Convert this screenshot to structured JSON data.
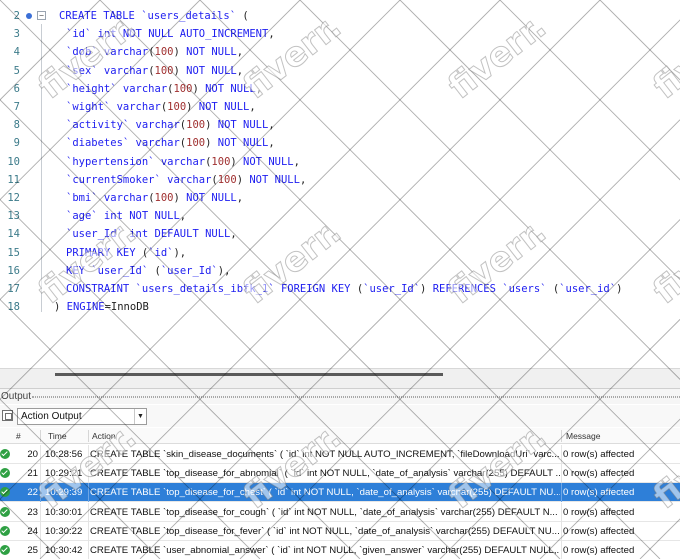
{
  "editor": {
    "lines": [
      {
        "n": "2",
        "t": [
          [
            "kw",
            "CREATE TABLE "
          ],
          [
            "id",
            "`users_details`"
          ],
          [
            "tx",
            " ("
          ]
        ]
      },
      {
        "n": "3",
        "t": [
          [
            "id",
            "`id`"
          ],
          [
            "kw",
            " int NOT NULL AUTO_INCREMENT"
          ],
          [
            "tx",
            ","
          ]
        ]
      },
      {
        "n": "4",
        "t": [
          [
            "id",
            "`dob`"
          ],
          [
            "kw",
            " varchar"
          ],
          [
            "tx",
            "("
          ],
          [
            "num",
            "100"
          ],
          [
            "tx",
            ")"
          ],
          [
            "kw",
            " NOT NULL"
          ],
          [
            "tx",
            ","
          ]
        ]
      },
      {
        "n": "5",
        "t": [
          [
            "id",
            "`sex`"
          ],
          [
            "kw",
            " varchar"
          ],
          [
            "tx",
            "("
          ],
          [
            "num",
            "100"
          ],
          [
            "tx",
            ")"
          ],
          [
            "kw",
            " NOT NULL"
          ],
          [
            "tx",
            ","
          ]
        ]
      },
      {
        "n": "6",
        "t": [
          [
            "id",
            "`height`"
          ],
          [
            "kw",
            " varchar"
          ],
          [
            "tx",
            "("
          ],
          [
            "num",
            "100"
          ],
          [
            "tx",
            ")"
          ],
          [
            "kw",
            " NOT NULL"
          ],
          [
            "tx",
            ","
          ]
        ]
      },
      {
        "n": "7",
        "t": [
          [
            "id",
            "`wight`"
          ],
          [
            "kw",
            " varchar"
          ],
          [
            "tx",
            "("
          ],
          [
            "num",
            "100"
          ],
          [
            "tx",
            ")"
          ],
          [
            "kw",
            " NOT NULL"
          ],
          [
            "tx",
            ","
          ]
        ]
      },
      {
        "n": "8",
        "t": [
          [
            "id",
            "`activity`"
          ],
          [
            "kw",
            " varchar"
          ],
          [
            "tx",
            "("
          ],
          [
            "num",
            "100"
          ],
          [
            "tx",
            ")"
          ],
          [
            "kw",
            " NOT NULL"
          ],
          [
            "tx",
            ","
          ]
        ]
      },
      {
        "n": "9",
        "t": [
          [
            "id",
            "`diabetes`"
          ],
          [
            "kw",
            " varchar"
          ],
          [
            "tx",
            "("
          ],
          [
            "num",
            "100"
          ],
          [
            "tx",
            ")"
          ],
          [
            "kw",
            " NOT NULL"
          ],
          [
            "tx",
            ","
          ]
        ]
      },
      {
        "n": "10",
        "t": [
          [
            "id",
            "`hypertension`"
          ],
          [
            "kw",
            " varchar"
          ],
          [
            "tx",
            "("
          ],
          [
            "num",
            "100"
          ],
          [
            "tx",
            ")"
          ],
          [
            "kw",
            " NOT NULL"
          ],
          [
            "tx",
            ","
          ]
        ]
      },
      {
        "n": "11",
        "t": [
          [
            "id",
            "`currentSmoker`"
          ],
          [
            "kw",
            " varchar"
          ],
          [
            "tx",
            "("
          ],
          [
            "num",
            "100"
          ],
          [
            "tx",
            ")"
          ],
          [
            "kw",
            " NOT NULL"
          ],
          [
            "tx",
            ","
          ]
        ]
      },
      {
        "n": "12",
        "t": [
          [
            "id",
            "`bmi`"
          ],
          [
            "kw",
            " varchar"
          ],
          [
            "tx",
            "("
          ],
          [
            "num",
            "100"
          ],
          [
            "tx",
            ")"
          ],
          [
            "kw",
            " NOT NULL"
          ],
          [
            "tx",
            ","
          ]
        ]
      },
      {
        "n": "13",
        "t": [
          [
            "id",
            "`age`"
          ],
          [
            "kw",
            " int NOT NULL"
          ],
          [
            "tx",
            ","
          ]
        ]
      },
      {
        "n": "14",
        "t": [
          [
            "id",
            "`user_Id`"
          ],
          [
            "kw",
            " int DEFAULT NULL"
          ],
          [
            "tx",
            ","
          ]
        ]
      },
      {
        "n": "15",
        "t": [
          [
            "kw",
            "PRIMARY KEY "
          ],
          [
            "tx",
            "("
          ],
          [
            "id",
            "`id`"
          ],
          [
            "tx",
            "),"
          ]
        ]
      },
      {
        "n": "16",
        "t": [
          [
            "kw",
            "KEY "
          ],
          [
            "id",
            "`user_Id`"
          ],
          [
            "tx",
            " ("
          ],
          [
            "id",
            "`user_Id`"
          ],
          [
            "tx",
            "),"
          ]
        ]
      },
      {
        "n": "17",
        "t": [
          [
            "kw",
            "CONSTRAINT "
          ],
          [
            "id",
            "`users_details_ibfk_1`"
          ],
          [
            "kw",
            " FOREIGN KEY "
          ],
          [
            "tx",
            "("
          ],
          [
            "id",
            "`user_Id`"
          ],
          [
            "tx",
            ") "
          ],
          [
            "kw",
            "REFERENCES "
          ],
          [
            "id",
            "`users`"
          ],
          [
            "tx",
            " ("
          ],
          [
            "id",
            "`user_id`"
          ],
          [
            "tx",
            ")"
          ]
        ]
      },
      {
        "n": "18",
        "t": [
          [
            "tx",
            ") "
          ],
          [
            "kw",
            "ENGINE"
          ],
          [
            "tx",
            "=InnoDB"
          ]
        ]
      }
    ]
  },
  "output": {
    "title": "Output",
    "dropdown_value": "Action Output",
    "columns": {
      "time": "Time",
      "action": "Action",
      "message": "Message",
      "num": "#"
    },
    "rows": [
      {
        "num": "20",
        "time": "10:28:56",
        "action": "CREATE TABLE `skin_disease_documents` (   `id` int NOT NULL AUTO_INCREMENT,   `fileDownloadUri` varc...",
        "message": "0 row(s) affected",
        "selected": false
      },
      {
        "num": "21",
        "time": "10:29:21",
        "action": "CREATE TABLE `top_disease_for_abnomial` (   `id` int NOT NULL,   `date_of_analysis` varchar(255) DEFAULT ...",
        "message": "0 row(s) affected",
        "selected": false
      },
      {
        "num": "22",
        "time": "10:29:39",
        "action": "CREATE TABLE `top_disease_for_chest` (   `id` int NOT NULL,   `date_of_analysis` varchar(255) DEFAULT NU...",
        "message": "0 row(s) affected",
        "selected": true
      },
      {
        "num": "23",
        "time": "10:30:01",
        "action": "CREATE TABLE `top_disease_for_cough` (   `id` int NOT NULL,   `date_of_analysis` varchar(255) DEFAULT N...",
        "message": "0 row(s) affected",
        "selected": false
      },
      {
        "num": "24",
        "time": "10:30:22",
        "action": "CREATE TABLE `top_disease_for_fever` (   `id` int NOT NULL,   `date_of_analysis` varchar(255) DEFAULT NU...",
        "message": "0 row(s) affected",
        "selected": false
      },
      {
        "num": "25",
        "time": "10:30:42",
        "action": "CREATE TABLE `user_abnomial_answer` (   `id` int NOT NULL,   `given_answer` varchar(255) DEFAULT NULL,...",
        "message": "0 row(s) affected",
        "selected": false
      }
    ]
  },
  "watermark": {
    "text": "fiverr."
  },
  "colors": {
    "keyword": "#1d1df0",
    "number": "#a03030",
    "line_number": "#3c7b8a",
    "selection": "#2e7fd8",
    "success": "#2ea043"
  }
}
